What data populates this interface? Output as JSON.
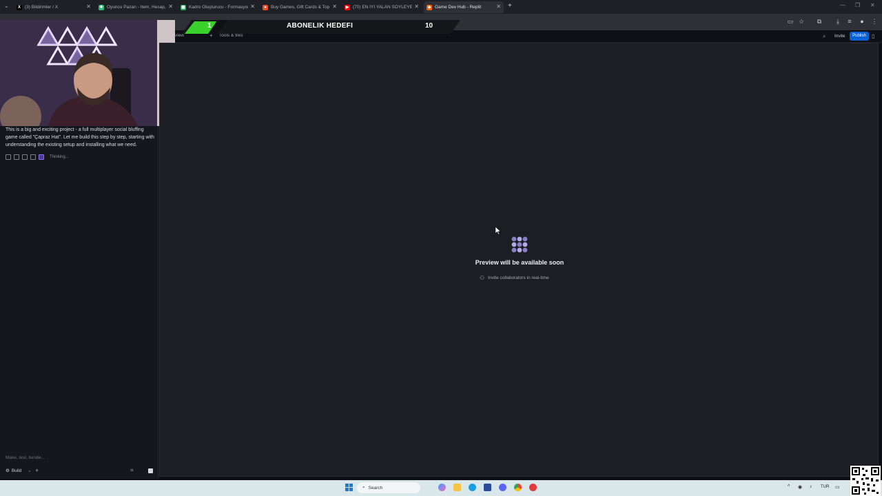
{
  "browser": {
    "tabs": [
      {
        "title": "(3) Bildirimler / X",
        "favicon": "x-icon",
        "color": "#000000",
        "active": false
      },
      {
        "title": "Oyuncu Pazarı - İtem, Hesap, S",
        "favicon": "puzzle-icon",
        "color": "#2bb673",
        "active": false
      },
      {
        "title": "Kadro Oluşturucu - Formasyon",
        "favicon": "sheet-icon",
        "color": "#22a35a",
        "active": false
      },
      {
        "title": "Buy Games, Gift Cards & Top U",
        "favicon": "shop-icon",
        "color": "#e44d26",
        "active": false
      },
      {
        "title": "(70) EN İYİ YALAN SÖYLEYEN O",
        "favicon": "youtube-icon",
        "color": "#ff0000",
        "active": false
      },
      {
        "title": "Game Dev Hub - Replit",
        "favicon": "replit-icon",
        "color": "#f26207",
        "active": true
      }
    ],
    "new_tab": "+"
  },
  "stream_overlay": {
    "left_number": "1",
    "banner_text": "ABONELIK HEDEFI",
    "right_number": "10"
  },
  "replit": {
    "tabs": {
      "preview": "view",
      "tools": "Tools & files"
    },
    "header": {
      "invite": "Invite",
      "publish": "Publish"
    },
    "chat": {
      "message": "This is a big and exciting project - a full multiplayer social bluffing game called \"Çapraz Hat\". Let me build this step by step, starting with understanding the existing setup and installing what we need.",
      "status": "Thinking...",
      "input_placeholder": "Make, test, iterate...",
      "mode": "Build"
    },
    "preview": {
      "title": "Preview will be available soon",
      "invite_text": "Invite collaborators in real-time"
    }
  },
  "taskbar": {
    "search_placeholder": "Search",
    "language": "TUR"
  },
  "colors": {
    "publish": "#0b62d6",
    "banner_green": "#3bd12c",
    "preview_bg": "#1c1e24",
    "panel_bg": "#15171c"
  }
}
